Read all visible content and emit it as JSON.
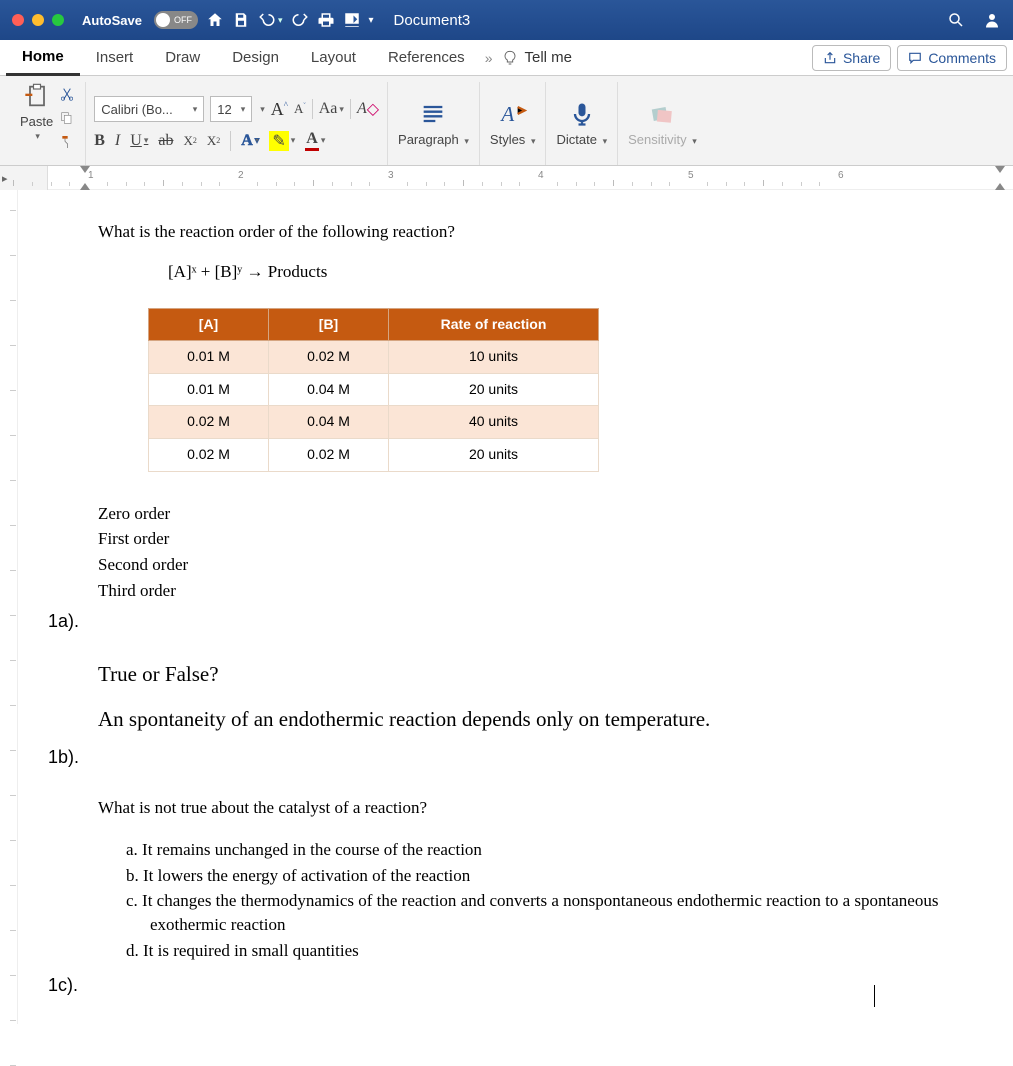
{
  "titlebar": {
    "autosave_label": "AutoSave",
    "autosave_state": "OFF",
    "doc_title": "Document3"
  },
  "tabs": {
    "items": [
      "Home",
      "Insert",
      "Draw",
      "Design",
      "Layout",
      "References"
    ],
    "more": "»",
    "tellme": "Tell me",
    "share": "Share",
    "comments": "Comments"
  },
  "ribbon": {
    "paste": "Paste",
    "font_name": "Calibri (Bo...",
    "font_size": "12",
    "aa_label": "Aa",
    "paragraph": "Paragraph",
    "styles": "Styles",
    "dictate": "Dictate",
    "sensitivity": "Sensitivity"
  },
  "ruler": {
    "marks": [
      "1",
      "2",
      "3",
      "4",
      "5",
      "6"
    ]
  },
  "doc": {
    "q1_prompt": "What is the reaction order of the following reaction?",
    "q1_formula": "[A]ˣ + [B]ʸ → Products",
    "table": {
      "headers": [
        "[A]",
        "[B]",
        "Rate of reaction"
      ],
      "rows": [
        [
          "0.01 M",
          "0.02 M",
          "10 units"
        ],
        [
          "0.01 M",
          "0.04 M",
          "20 units"
        ],
        [
          "0.02 M",
          "0.04 M",
          "40 units"
        ],
        [
          "0.02 M",
          "0.02 M",
          "20 units"
        ]
      ]
    },
    "q1_opts": [
      "Zero order",
      "First order",
      "Second order",
      "Third order"
    ],
    "label_1a": "1a).",
    "tf_head": "True or False?",
    "tf_stmt": "An spontaneity of an endothermic reaction depends only on temperature.",
    "label_1b": "1b).",
    "q3_prompt": "What is not true about the catalyst of a reaction?",
    "q3_opts": [
      "It remains unchanged in the course of the reaction",
      "It lowers the energy of activation of the reaction",
      "It changes the thermodynamics of the reaction and converts a nonspontaneous endothermic reaction to a spontaneous exothermic reaction",
      "It is required in small quantities"
    ],
    "q3_letters": [
      "a.",
      "b.",
      "c.",
      "d."
    ],
    "label_1c": "1c)."
  }
}
